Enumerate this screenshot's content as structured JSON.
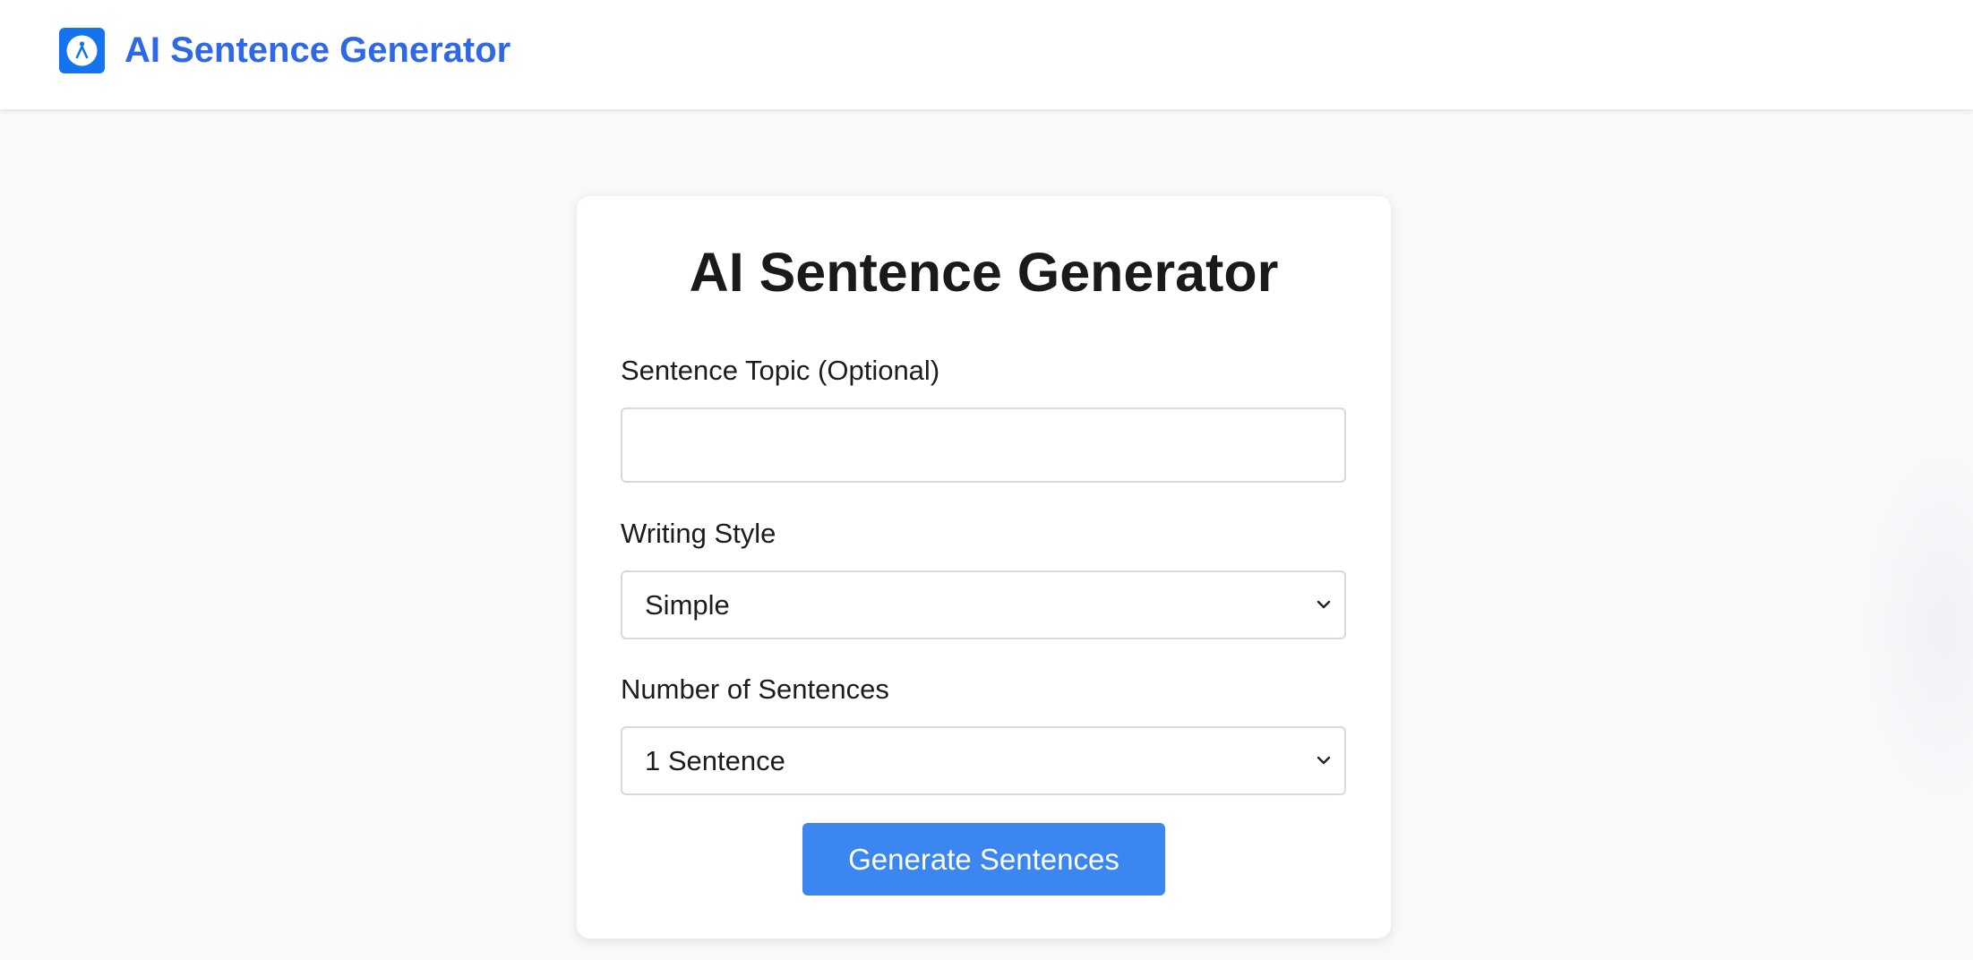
{
  "colors": {
    "brand": "#2f68e6",
    "logo_bg": "#1474f0",
    "button_bg": "#3b86f0",
    "card_bg": "#ffffff",
    "page_bg": "#f8f9fb"
  },
  "header": {
    "logo_icon": "compass-person-icon",
    "title": "AI Sentence Generator"
  },
  "form": {
    "title": "AI Sentence Generator",
    "topic": {
      "label": "Sentence Topic (Optional)",
      "value": "",
      "placeholder": ""
    },
    "style": {
      "label": "Writing Style",
      "selected": "Simple",
      "icon": "chevron-down-icon"
    },
    "count": {
      "label": "Number of Sentences",
      "selected": "1 Sentence",
      "icon": "chevron-down-icon"
    },
    "submit_label": "Generate Sentences"
  }
}
